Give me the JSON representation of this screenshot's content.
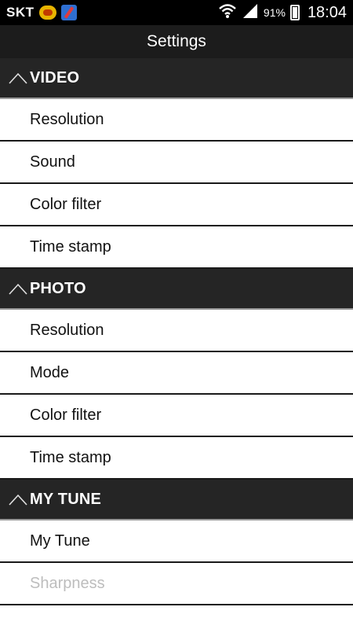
{
  "status_bar": {
    "carrier": "SKT",
    "battery_percent": "91%",
    "time": "18:04",
    "icons": [
      "app-badge-icon",
      "app-icon",
      "wifi-icon",
      "signal-icon",
      "battery-charging-icon"
    ]
  },
  "action_bar": {
    "title": "Settings"
  },
  "sections": [
    {
      "title": "VIDEO",
      "items": [
        "Resolution",
        "Sound",
        "Color filter",
        "Time stamp"
      ]
    },
    {
      "title": "PHOTO",
      "items": [
        "Resolution",
        "Mode",
        "Color filter",
        "Time stamp"
      ]
    },
    {
      "title": "MY TUNE",
      "items": [
        "My Tune",
        "Sharpness"
      ]
    }
  ],
  "colors": {
    "header_bg": "#252525",
    "action_bar_bg": "#1c1c1c",
    "disabled_text": "#bdbdbd"
  }
}
